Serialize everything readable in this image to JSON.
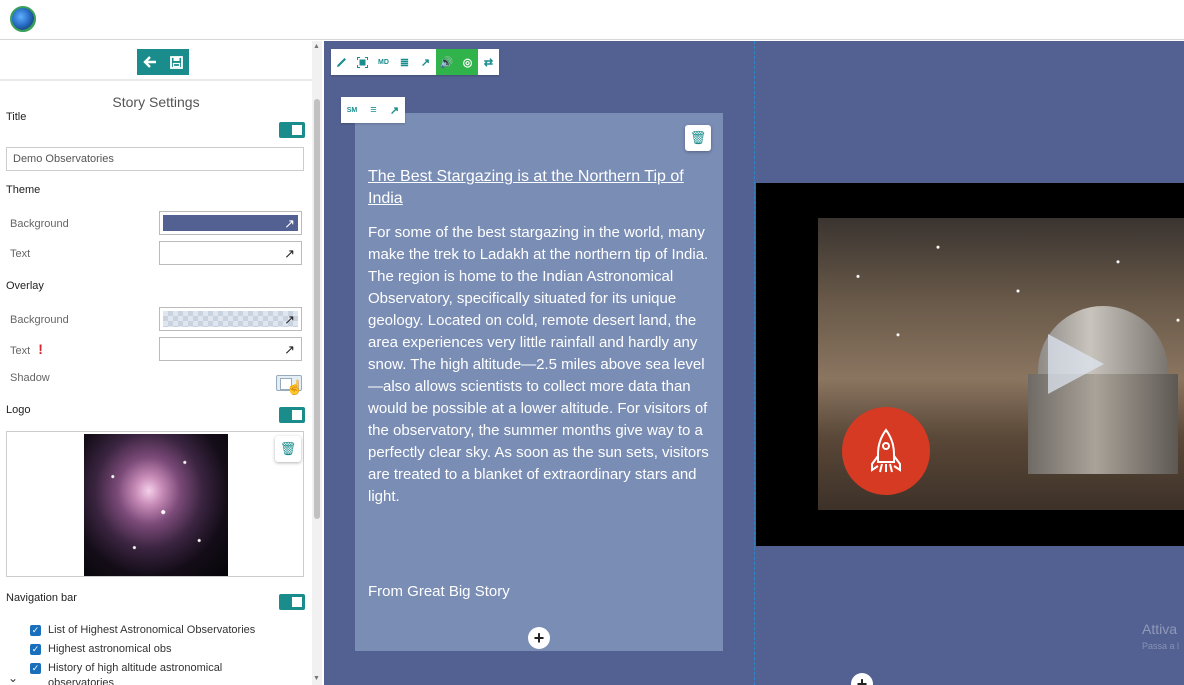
{
  "left_toolbar": {
    "back_icon": "arrow-left-icon",
    "save_icon": "save-icon"
  },
  "story_settings": {
    "heading": "Story Settings",
    "title_label": "Title",
    "title_value": "Demo Observatories",
    "theme_label": "Theme",
    "theme_background_label": "Background",
    "theme_background_color": "#536192",
    "theme_text_label": "Text",
    "overlay_label": "Overlay",
    "overlay_background_label": "Background",
    "overlay_text_label": "Text",
    "overlay_text_warning": "!",
    "shadow_label": "Shadow",
    "logo_label": "Logo",
    "navigation_label": "Navigation bar",
    "nav_items": [
      "List of Highest Astronomical Observatories",
      "Highest astronomical obs",
      "History of high altitude astronomical"
    ],
    "nav_item_overflow": "observatories"
  },
  "canvas": {
    "background_color": "#536192",
    "main_toolbar": {
      "items": [
        "pencil-icon",
        "fit-icon",
        "MD",
        "align-right-icon",
        "eyedropper-icon",
        "volume-icon",
        "play-icon",
        "repeat-icon"
      ],
      "md_label": "MD"
    },
    "card_toolbar": {
      "sm_label": "SM"
    },
    "card": {
      "title": "The Best Stargazing is at the Northern Tip of India",
      "body": "For some of the best stargazing in the world, many make the trek to Ladakh at the northern tip of India. The region is home to the Indian Astronomical Observatory, specifically situated for its unique geology. Located on cold, remote desert land, the area experiences very little rainfall and hardly any snow. The high altitude—2.5 miles above sea level—also allows scientists to collect more data than would be possible at a lower altitude. For visitors of the observatory, the summer months give way to a perfectly clear sky. As soon as the sun sets, visitors are treated to a blanket of extraordinary stars and light.",
      "source": "From Great Big Story"
    },
    "watermark_line1": "Attiva",
    "watermark_line2": "Passa a l"
  }
}
